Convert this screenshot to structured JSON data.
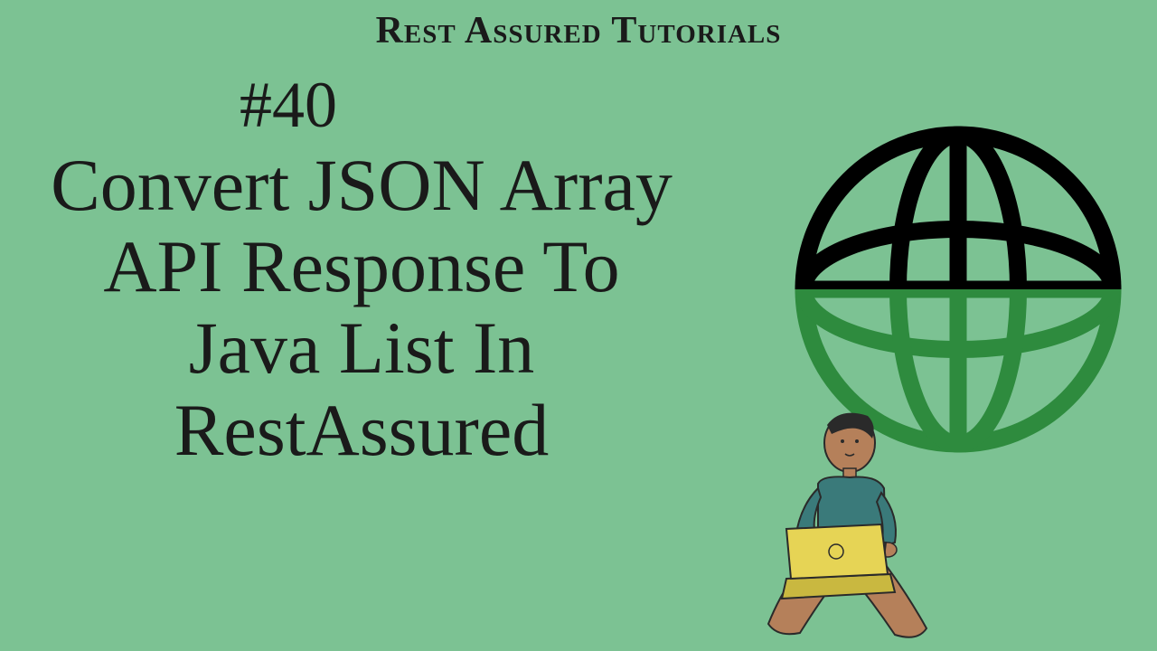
{
  "series": {
    "title": "Rest Assured Tutorials"
  },
  "episode": {
    "number": "#40",
    "title": "Convert JSON Array API Response To Java List In RestAssured"
  },
  "colors": {
    "background": "#7cc293",
    "text": "#1a1a1a",
    "globe_dark": "#000000",
    "globe_green": "#2e8b3e",
    "laptop": "#e6d455"
  }
}
